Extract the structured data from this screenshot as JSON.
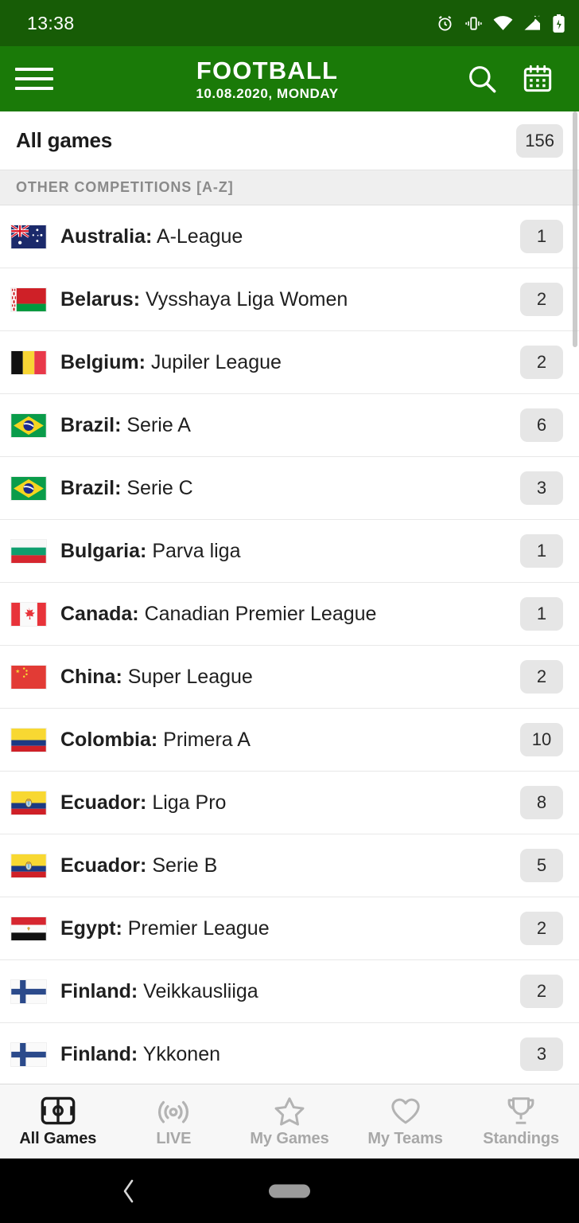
{
  "status_bar": {
    "time": "13:38",
    "icons": [
      "alarm-icon",
      "vibrate-icon",
      "wifi-icon",
      "signal-icon",
      "battery-charging-icon"
    ],
    "background": "#175c06"
  },
  "app_bar": {
    "menu_icon": "hamburger-icon",
    "title": "FOOTBALL",
    "subtitle": "10.08.2020, MONDAY",
    "search_icon": "search-icon",
    "calendar_icon": "calendar-icon",
    "background": "#1a7a08"
  },
  "all_games": {
    "label": "All games",
    "count": "156"
  },
  "section_header": {
    "label": "OTHER COMPETITIONS [A-Z]"
  },
  "competitions": [
    {
      "country": "Australia:",
      "league": "A-League",
      "count": "1",
      "flag": "flag-australia"
    },
    {
      "country": "Belarus:",
      "league": "Vysshaya Liga Women",
      "count": "2",
      "flag": "flag-belarus"
    },
    {
      "country": "Belgium:",
      "league": "Jupiler League",
      "count": "2",
      "flag": "flag-belgium"
    },
    {
      "country": "Brazil:",
      "league": "Serie A",
      "count": "6",
      "flag": "flag-brazil"
    },
    {
      "country": "Brazil:",
      "league": "Serie C",
      "count": "3",
      "flag": "flag-brazil"
    },
    {
      "country": "Bulgaria:",
      "league": "Parva liga",
      "count": "1",
      "flag": "flag-bulgaria"
    },
    {
      "country": "Canada:",
      "league": "Canadian Premier League",
      "count": "1",
      "flag": "flag-canada"
    },
    {
      "country": "China:",
      "league": "Super League",
      "count": "2",
      "flag": "flag-china"
    },
    {
      "country": "Colombia:",
      "league": "Primera A",
      "count": "10",
      "flag": "flag-colombia"
    },
    {
      "country": "Ecuador:",
      "league": "Liga Pro",
      "count": "8",
      "flag": "flag-ecuador"
    },
    {
      "country": "Ecuador:",
      "league": "Serie B",
      "count": "5",
      "flag": "flag-ecuador"
    },
    {
      "country": "Egypt:",
      "league": "Premier League",
      "count": "2",
      "flag": "flag-egypt"
    },
    {
      "country": "Finland:",
      "league": "Veikkausliiga",
      "count": "2",
      "flag": "flag-finland"
    },
    {
      "country": "Finland:",
      "league": "Ykkonen",
      "count": "3",
      "flag": "flag-finland"
    }
  ],
  "bottom_nav": [
    {
      "label": "All Games",
      "icon": "pitch-icon",
      "active": true
    },
    {
      "label": "LIVE",
      "icon": "broadcast-icon",
      "active": false
    },
    {
      "label": "My Games",
      "icon": "star-icon",
      "active": false
    },
    {
      "label": "My Teams",
      "icon": "heart-icon",
      "active": false
    },
    {
      "label": "Standings",
      "icon": "trophy-icon",
      "active": false
    }
  ],
  "android_nav": {
    "back_icon": "back-chevron-icon",
    "home_icon": "home-pill-icon"
  }
}
